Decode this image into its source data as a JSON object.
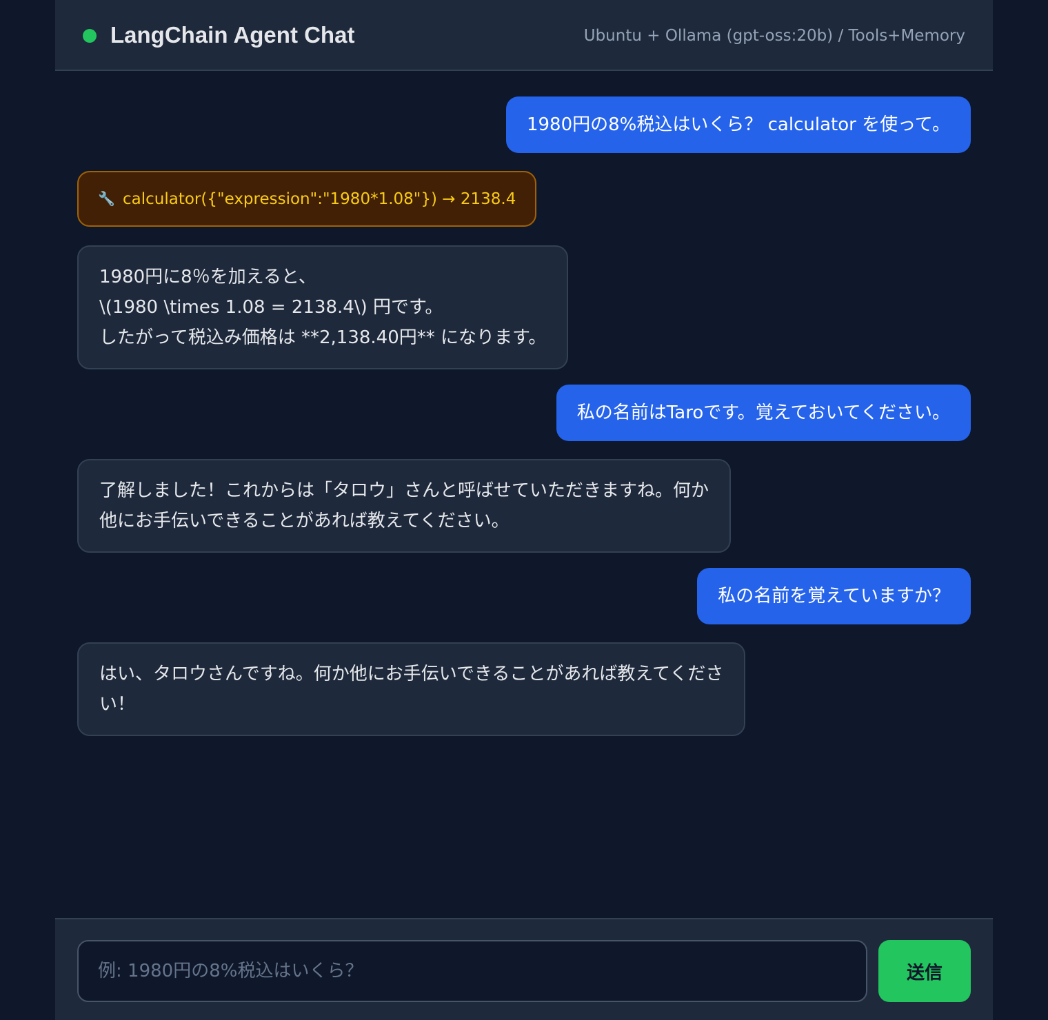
{
  "header": {
    "title": "LangChain Agent Chat",
    "subtitle": "Ubuntu + Ollama (gpt-oss:20b) / Tools+Memory",
    "status_color": "#22c55e"
  },
  "messages": [
    {
      "role": "user",
      "text": "1980円の8%税込はいくら？ calculator を使って。"
    },
    {
      "role": "tool",
      "icon": "wrench-icon",
      "text": "calculator({\"expression\":\"1980*1.08\"}) → 2138.4"
    },
    {
      "role": "assistant",
      "lines": [
        "1980円に8％を加えると、",
        "\\(1980 \\times 1.08 = 2138.4\\) 円です。",
        "したがって税込み価格は **2,138.40円** になります。"
      ]
    },
    {
      "role": "user",
      "text": "私の名前はTaroです。覚えておいてください。"
    },
    {
      "role": "assistant",
      "lines": [
        "了解しました！これからは「タロウ」さんと呼ばせていただきますね。何か",
        "他にお手伝いできることがあれば教えてください。"
      ]
    },
    {
      "role": "user",
      "text": "私の名前を覚えていますか？"
    },
    {
      "role": "assistant",
      "lines": [
        "はい、タロウさんですね。何か他にお手伝いできることがあれば教えてくださ",
        "い！"
      ]
    }
  ],
  "composer": {
    "placeholder": "例: 1980円の8%税込はいくら？",
    "value": "",
    "send_label": "送信"
  },
  "colors": {
    "background": "#0f172a",
    "panel": "#1e293b",
    "user_bubble": "#2563eb",
    "tool_bubble": "#422006",
    "tool_text": "#facc15",
    "send_button": "#22c55e"
  }
}
